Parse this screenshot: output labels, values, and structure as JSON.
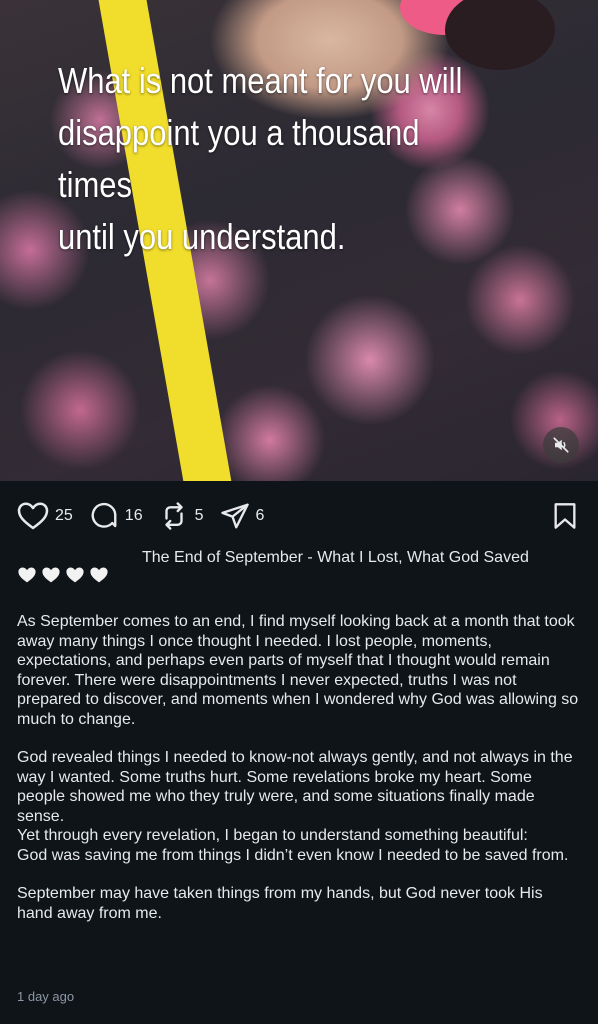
{
  "media": {
    "overlay_text": "What is not meant for you will\ndisappoint you a thousand times\nuntil you understand.",
    "mute_icon": "speaker-muted-icon"
  },
  "actions": {
    "likes": "25",
    "replies": "16",
    "reposts": "5",
    "shares": "6"
  },
  "post": {
    "title": "The End of September - What I Lost, What God Saved",
    "paragraphs": [
      "As September comes to an end, I find myself looking back at a month that took away many things I once thought I needed. I lost people, moments, expectations, and perhaps even parts of myself that I thought would remain forever. There were disappointments I never expected, truths I was not prepared to discover, and moments when I wondered why God was allowing so much to change.",
      "God revealed things I needed to know-not always gently, and not always in the way I wanted. Some truths hurt. Some revelations broke my heart. Some people showed me who they truly were, and some situations finally made sense.\nYet through every revelation, I began to understand something beautiful:\nGod was saving me from things I didn’t even know I needed to be saved from.",
      "September may have taken things from my hands, but God never took His hand away from me."
    ],
    "timestamp": "1 day ago"
  },
  "colors": {
    "background": "#0f1419",
    "text": "#e7e9ea",
    "muted": "#8b98a5",
    "strap": "#f1dd2b"
  }
}
